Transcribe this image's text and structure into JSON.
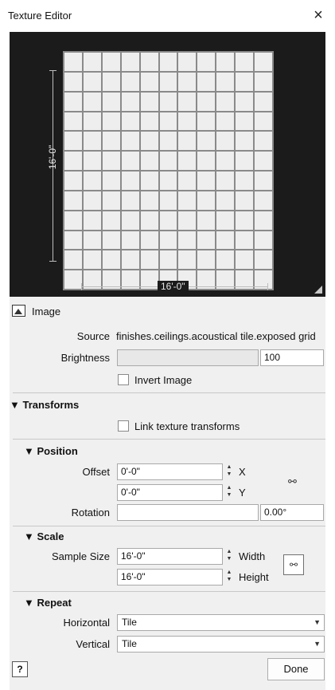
{
  "window": {
    "title": "Texture Editor",
    "close_glyph": "×"
  },
  "preview": {
    "vertical_dimension": "16'-0\"",
    "horizontal_dimension": "16'-0\"",
    "grid_columns": 11,
    "grid_rows": 12
  },
  "image_section": {
    "label": "Image",
    "icon": "image-icon",
    "source_label": "Source",
    "source_value": "finishes.ceilings.acoustical tile.exposed grid",
    "brightness_label": "Brightness",
    "brightness_value": "100",
    "invert_label": "Invert Image",
    "invert_checked": false
  },
  "transforms": {
    "header": "▼ Transforms",
    "link_label": "Link texture transforms",
    "link_checked": false
  },
  "position": {
    "header": "▼ Position",
    "offset_label": "Offset",
    "offset_x": "0'-0\"",
    "offset_y": "0'-0\"",
    "x_label": "X",
    "y_label": "Y",
    "rotation_label": "Rotation",
    "rotation_value": "0.00°",
    "link_icon": "chain-link-icon"
  },
  "scale": {
    "header": "▼ Scale",
    "sample_size_label": "Sample Size",
    "width_value": "16'-0\"",
    "height_value": "16'-0\"",
    "width_label": "Width",
    "height_label": "Height"
  },
  "repeat": {
    "header": "▼ Repeat",
    "horizontal_label": "Horizontal",
    "horizontal_value": "Tile",
    "vertical_label": "Vertical",
    "vertical_value": "Tile"
  },
  "footer": {
    "help_label": "?",
    "done_label": "Done"
  },
  "colors": {
    "preview_bg": "#1b1b1b",
    "panel_bg": "#f0f0f0",
    "tile": "#eeeeee",
    "grout": "#8a8a8a"
  }
}
